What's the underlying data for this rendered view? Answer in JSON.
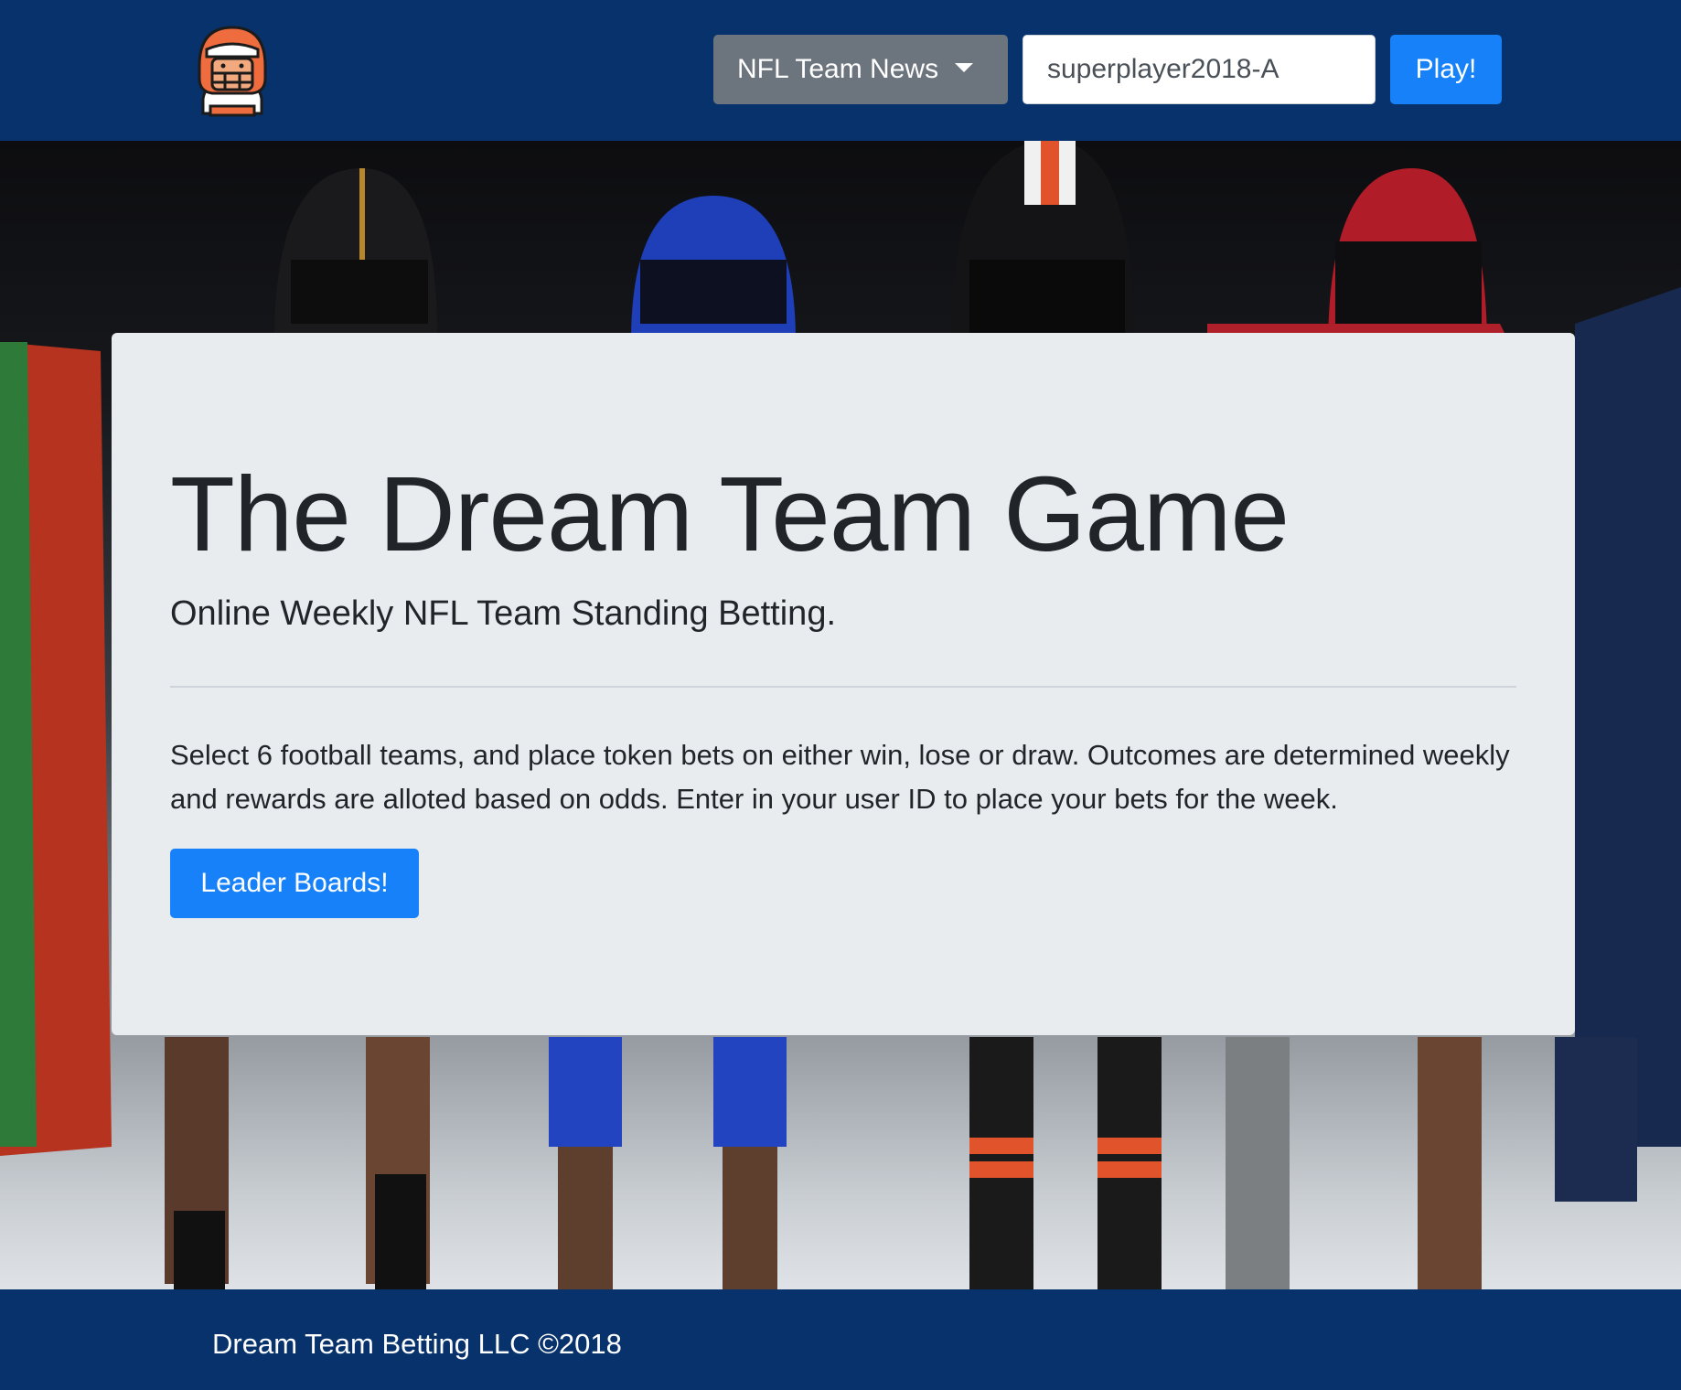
{
  "navbar": {
    "logo_icon": "football-player-icon",
    "dropdown_label": "NFL Team News",
    "user_id_value": "superplayer2018-A",
    "play_label": "Play!"
  },
  "hero": {
    "background": "photo of football players in helmets and uniforms"
  },
  "jumbotron": {
    "title": "The Dream Team Game",
    "lead": "Online Weekly NFL Team Standing Betting.",
    "description": "Select 6 football teams, and place token bets on either win, lose or draw. Outcomes are determined weekly and rewards are alloted based on odds. Enter in your user ID to place your bets for the week.",
    "leader_button": "Leader Boards!"
  },
  "footer": {
    "text": "Dream Team Betting LLC ©2018"
  },
  "colors": {
    "navbar": "#07326b",
    "primary": "#1681f9",
    "secondary": "#6c757d",
    "jumbotron": "#e9ecef"
  }
}
